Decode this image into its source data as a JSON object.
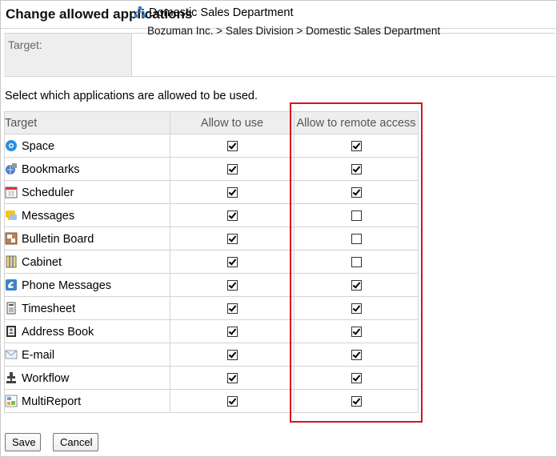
{
  "page": {
    "title": "Change allowed applications"
  },
  "target": {
    "label": "Target:",
    "department": "Domestic Sales Department",
    "path": "Bozuman Inc. > Sales Division > Domestic Sales Department"
  },
  "instruction": "Select which applications are allowed to be used.",
  "table": {
    "headers": {
      "target": "Target",
      "use": "Allow to use",
      "remote": "Allow to remote access"
    },
    "rows": [
      {
        "name": "Space",
        "icon": "space-icon",
        "use": true,
        "remote": true
      },
      {
        "name": "Bookmarks",
        "icon": "bookmarks-icon",
        "use": true,
        "remote": true
      },
      {
        "name": "Scheduler",
        "icon": "scheduler-icon",
        "use": true,
        "remote": true
      },
      {
        "name": "Messages",
        "icon": "messages-icon",
        "use": true,
        "remote": false
      },
      {
        "name": "Bulletin Board",
        "icon": "bulletin-board-icon",
        "use": true,
        "remote": false
      },
      {
        "name": "Cabinet",
        "icon": "cabinet-icon",
        "use": true,
        "remote": false
      },
      {
        "name": "Phone Messages",
        "icon": "phone-messages-icon",
        "use": true,
        "remote": true
      },
      {
        "name": "Timesheet",
        "icon": "timesheet-icon",
        "use": true,
        "remote": true
      },
      {
        "name": "Address Book",
        "icon": "address-book-icon",
        "use": true,
        "remote": true
      },
      {
        "name": "E-mail",
        "icon": "email-icon",
        "use": true,
        "remote": true
      },
      {
        "name": "Workflow",
        "icon": "workflow-icon",
        "use": true,
        "remote": true
      },
      {
        "name": "MultiReport",
        "icon": "multireport-icon",
        "use": true,
        "remote": true
      }
    ]
  },
  "buttons": {
    "save": "Save",
    "cancel": "Cancel"
  },
  "colors": {
    "highlight": "#d9141b",
    "header_bg": "#eeeeee",
    "border": "#d3d3d3"
  }
}
